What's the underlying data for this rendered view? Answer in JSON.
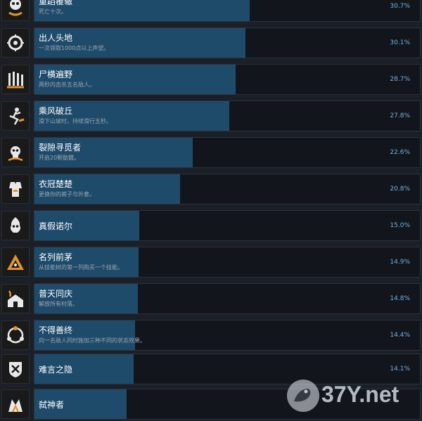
{
  "achievements": [
    {
      "title": "重蹈覆辙",
      "desc": "死亡十次。",
      "percent": "30.7%",
      "fill_fraction": 0.307,
      "icon": "reaper-icon"
    },
    {
      "title": "出人头地",
      "desc": "一次领取1000点以上声望。",
      "percent": "30.1%",
      "fill_fraction": 0.301,
      "icon": "target-icon"
    },
    {
      "title": "尸横遍野",
      "desc": "两秒内击杀五名敌人。",
      "percent": "28.7%",
      "fill_fraction": 0.287,
      "icon": "corpses-icon"
    },
    {
      "title": "乘风破丘",
      "desc": "滑下山坡时，持续滑行五秒。",
      "percent": "27.8%",
      "fill_fraction": 0.278,
      "icon": "slide-icon"
    },
    {
      "title": "裂隙寻觅者",
      "desc": "开启20颗骷髅。",
      "percent": "22.6%",
      "fill_fraction": 0.226,
      "icon": "skull-icon"
    },
    {
      "title": "衣冠楚楚",
      "desc": "更换你的裤子与外套。",
      "percent": "20.8%",
      "fill_fraction": 0.208,
      "icon": "outfit-icon"
    },
    {
      "title": "真假诺尔",
      "desc": "",
      "percent": "15.0%",
      "fill_fraction": 0.15,
      "icon": "flame-skull-icon"
    },
    {
      "title": "名列前茅",
      "desc": "从技能树的第一列购买一个技能。",
      "percent": "14.9%",
      "fill_fraction": 0.149,
      "icon": "pyramid-icon"
    },
    {
      "title": "普天同庆",
      "desc": "解放所有村落。",
      "percent": "14.8%",
      "fill_fraction": 0.148,
      "icon": "village-icon"
    },
    {
      "title": "不得善终",
      "desc": "向一名敌人同时施加三种不同的状态效果。",
      "percent": "14.4%",
      "fill_fraction": 0.144,
      "icon": "ring-icon"
    },
    {
      "title": "难言之隐",
      "desc": "",
      "percent": "14.1%",
      "fill_fraction": 0.141,
      "icon": "shield-icon"
    },
    {
      "title": "弑神者",
      "desc": "",
      "percent": "",
      "fill_fraction": 0.131,
      "icon": "godslayer-icon"
    }
  ],
  "watermark": {
    "text": "37Y.net"
  },
  "colors": {
    "bar_fill": "#1f4b6b",
    "percent_text": "#79aee0",
    "icon_accent": "#e0962e"
  }
}
